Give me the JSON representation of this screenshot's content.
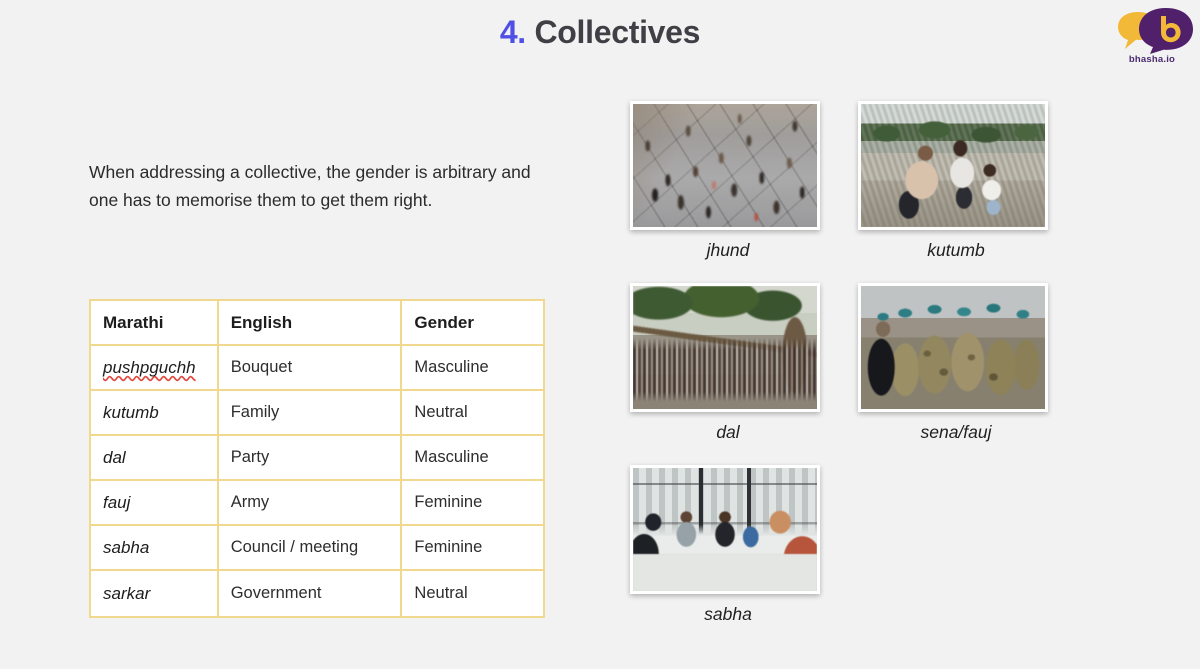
{
  "header": {
    "number": "4.",
    "title": "Collectives"
  },
  "brand": {
    "name": "bhasha.io",
    "bubble_back_color": "#f2b938",
    "bubble_front_color": "#51206b",
    "letter": "b"
  },
  "intro": {
    "text": "When addressing a collective, the gender is arbitrary and one has to memorise them to get them right."
  },
  "table": {
    "columns": [
      "Marathi",
      "English",
      "Gender"
    ],
    "border_color": "#f0d98e",
    "rows": [
      {
        "marathi": "pushpguchh",
        "english": "Bouquet",
        "gender": "Masculine",
        "misspelled": true
      },
      {
        "marathi": "kutumb",
        "english": "Family",
        "gender": "Neutral",
        "misspelled": false
      },
      {
        "marathi": "dal",
        "english": "Party",
        "gender": "Masculine",
        "misspelled": false
      },
      {
        "marathi": "fauj",
        "english": "Army",
        "gender": "Feminine",
        "misspelled": false
      },
      {
        "marathi": "sabha",
        "english": "Council / meeting",
        "gender": "Feminine",
        "misspelled": false
      },
      {
        "marathi": "sarkar",
        "english": "Government",
        "gender": "Neutral",
        "misspelled": false
      }
    ]
  },
  "gallery": {
    "photos": [
      {
        "caption": "jhund",
        "subject": "crowd-of-people-aerial-view"
      },
      {
        "caption": "kutumb",
        "subject": "family-on-riverbank"
      },
      {
        "caption": "dal",
        "subject": "political-gathering-under-tree"
      },
      {
        "caption": "sena/fauj",
        "subject": "soldiers-marching-from-behind"
      },
      {
        "caption": "sabha",
        "subject": "people-meeting-around-table"
      }
    ]
  },
  "theme": {
    "background": "#f2f2f2",
    "accent": "#5050e6",
    "text": "#2d2d2d"
  }
}
